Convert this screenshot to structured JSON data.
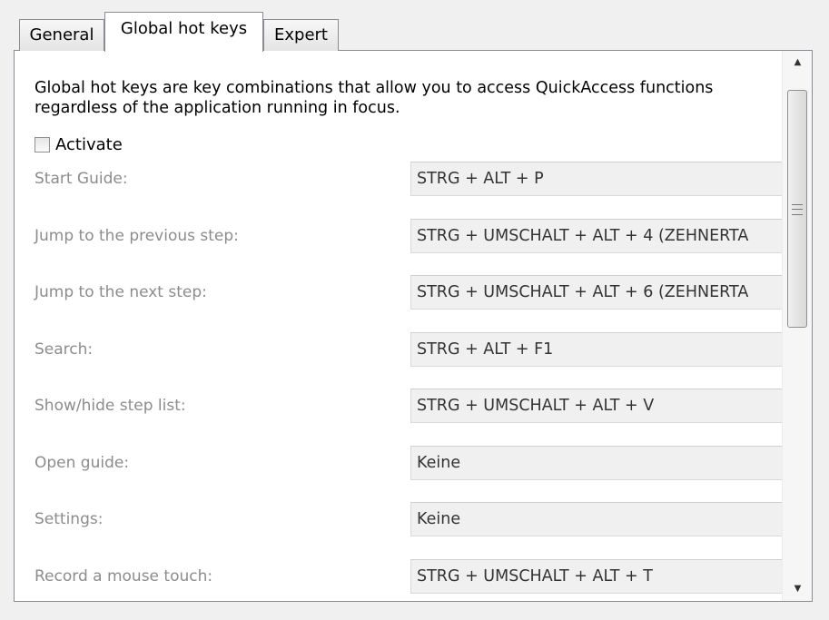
{
  "tabs": [
    {
      "label": "General",
      "active": false
    },
    {
      "label": "Global hot keys",
      "active": true
    },
    {
      "label": "Expert",
      "active": false
    }
  ],
  "intro": "Global hot keys are key combinations that allow you to access QuickAccess functions regardless of the application running in focus.",
  "activate": {
    "label": "Activate",
    "checked": false
  },
  "hotkeys": [
    {
      "label": "Start Guide:",
      "value": "STRG + ALT + P"
    },
    {
      "label": "Jump to the previous step:",
      "value": "STRG + UMSCHALT + ALT + 4 (ZEHNERTA"
    },
    {
      "label": "Jump to the next step:",
      "value": "STRG + UMSCHALT + ALT + 6 (ZEHNERTA"
    },
    {
      "label": "Search:",
      "value": "STRG + ALT + F1"
    },
    {
      "label": "Show/hide step list:",
      "value": "STRG + UMSCHALT + ALT + V"
    },
    {
      "label": "Open guide:",
      "value": "Keine"
    },
    {
      "label": "Settings:",
      "value": "Keine"
    },
    {
      "label": "Record a mouse touch:",
      "value": "STRG + UMSCHALT + ALT + T"
    }
  ],
  "scrollbar": {
    "up_icon": "scroll-up-arrow",
    "down_icon": "scroll-down-arrow"
  }
}
